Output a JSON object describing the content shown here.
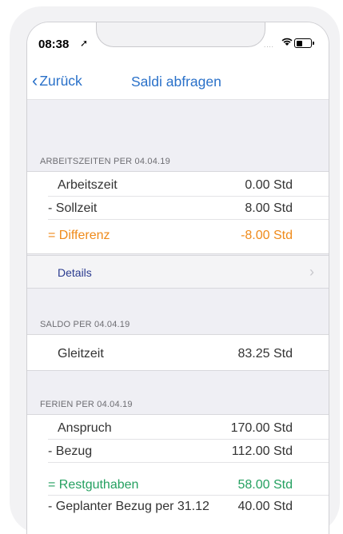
{
  "status": {
    "time": "08:38",
    "loc_icon": "➤",
    "signal": "....",
    "wifi_icon": "wifi"
  },
  "nav": {
    "back_label": "Zurück",
    "title": "Saldi abfragen"
  },
  "sections": {
    "arbeit": {
      "header": "ARBEITSZEITEN PER 04.04.19",
      "rows": [
        {
          "label": "Arbeitszeit",
          "value": "0.00 Std"
        },
        {
          "label": "- Sollzeit",
          "value": "8.00 Std"
        },
        {
          "label": "= Differenz",
          "value": "-8.00 Std"
        }
      ],
      "details_label": "Details"
    },
    "saldo": {
      "header": "SALDO PER 04.04.19",
      "rows": [
        {
          "label": "Gleitzeit",
          "value": "83.25 Std"
        }
      ]
    },
    "ferien": {
      "header": "FERIEN PER 04.04.19",
      "rows": [
        {
          "label": "Anspruch",
          "value": "170.00 Std"
        },
        {
          "label": "- Bezug",
          "value": "112.00 Std"
        },
        {
          "label": "= Restguthaben",
          "value": "58.00 Std"
        },
        {
          "label": "- Geplanter Bezug per 31.12",
          "value": "40.00 Std"
        }
      ]
    }
  },
  "colors": {
    "accent": "#2a71c9",
    "negative": "#ef8a1a",
    "positive": "#24a060"
  }
}
